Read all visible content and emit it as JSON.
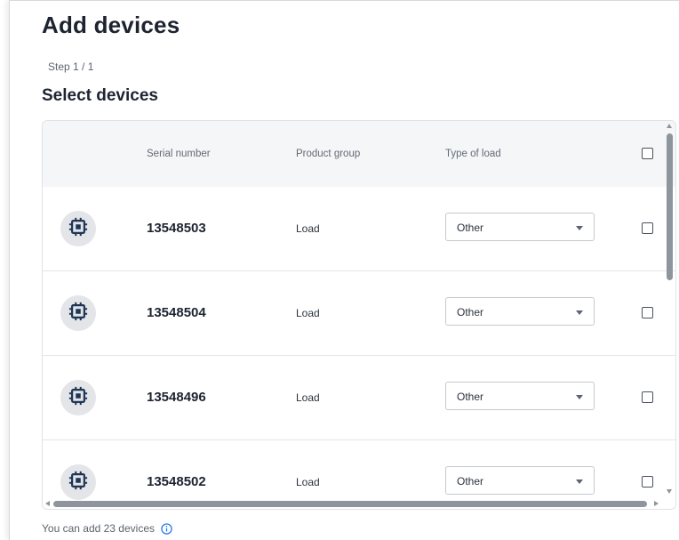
{
  "page": {
    "title": "Add devices",
    "step": "Step 1 / 1",
    "subtitle": "Select devices"
  },
  "table": {
    "columns": {
      "serial": "Serial number",
      "product_group": "Product group",
      "type_of_load": "Type of load"
    },
    "rows": [
      {
        "icon": "chip-icon",
        "serial": "13548503",
        "product_group": "Load",
        "type_of_load": "Other",
        "checked": false
      },
      {
        "icon": "chip-icon",
        "serial": "13548504",
        "product_group": "Load",
        "type_of_load": "Other",
        "checked": false
      },
      {
        "icon": "chip-icon",
        "serial": "13548496",
        "product_group": "Load",
        "type_of_load": "Other",
        "checked": false
      },
      {
        "icon": "chip-icon",
        "serial": "13548502",
        "product_group": "Load",
        "type_of_load": "Other",
        "checked": false
      }
    ]
  },
  "footer": {
    "text": "You can add 23 devices",
    "icon": "info-icon"
  },
  "colors": {
    "accent": "#1a73e8",
    "icon_dark": "#1f3556"
  }
}
